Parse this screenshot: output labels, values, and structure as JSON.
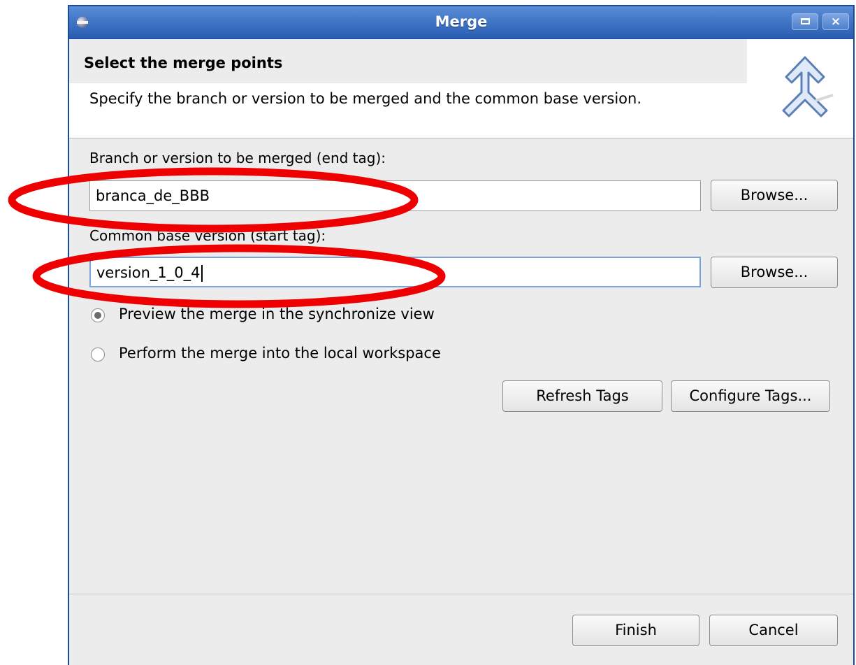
{
  "window": {
    "title": "Merge"
  },
  "header": {
    "title": "Select the merge points",
    "description": "Specify the branch or version to be merged and the common base version."
  },
  "form": {
    "end_tag_label": "Branch or version to be merged (end tag):",
    "end_tag_value": "branca_de_BBB",
    "start_tag_label": "Common base version (start tag):",
    "start_tag_value": "version_1_0_4",
    "browse_label": "Browse..."
  },
  "options": {
    "preview_label": "Preview the merge in the synchronize view",
    "preview_checked": true,
    "perform_label": "Perform the merge into the local workspace",
    "perform_checked": false
  },
  "tag_buttons": {
    "refresh_label": "Refresh Tags",
    "configure_label": "Configure Tags..."
  },
  "footer": {
    "finish_label": "Finish",
    "cancel_label": "Cancel"
  },
  "colors": {
    "annotation": "#ee0000",
    "titlebar": "#3f74c4"
  }
}
